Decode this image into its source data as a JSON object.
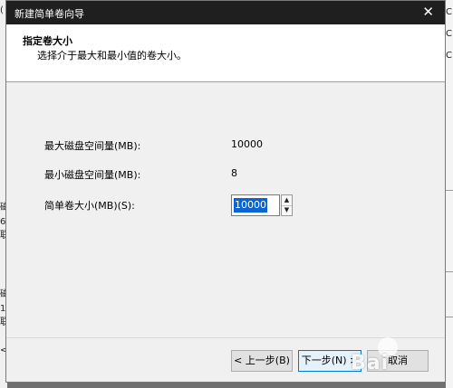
{
  "dialog": {
    "title": "新建简单卷向导",
    "close_glyph": "✕",
    "header": {
      "title": "指定卷大小",
      "subtitle": "选择介于最大和最小值的卷大小。"
    },
    "fields": {
      "max_label": "最大磁盘空间量(MB):",
      "max_value": "10000",
      "min_label": "最小磁盘空间量(MB):",
      "min_value": "8",
      "size_label": "简单卷大小(MB)(S):",
      "size_value": "10000"
    },
    "buttons": {
      "back": "< 上一步(B)",
      "next": "下一步(N) >",
      "cancel": "取消"
    }
  },
  "background": {
    "left_chars": [
      "(",
      "磁",
      "6",
      "联",
      "磁",
      "1",
      "联",
      "<"
    ],
    "right_chars": [
      "C",
      "C",
      "C"
    ]
  },
  "watermark": {
    "text": "Bai"
  }
}
